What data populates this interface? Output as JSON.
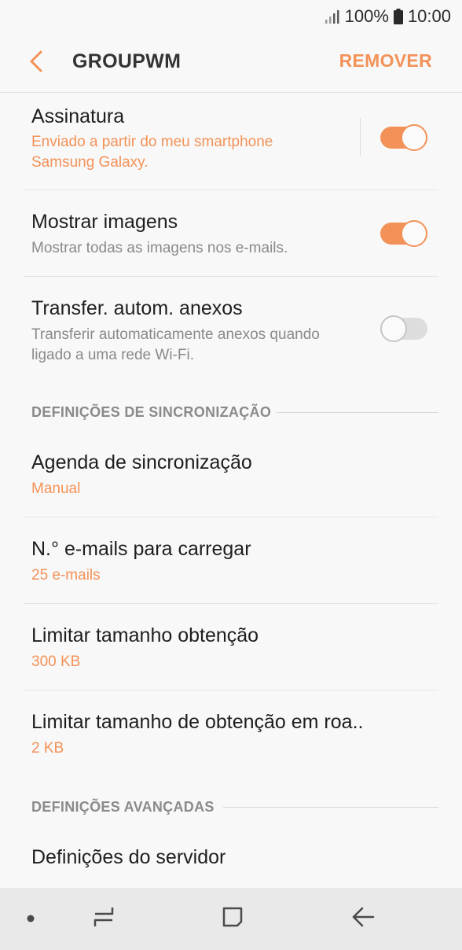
{
  "status_bar": {
    "battery": "100%",
    "time": "10:00"
  },
  "app_bar": {
    "title": "GROUPWM",
    "remove_label": "REMOVER"
  },
  "signature": {
    "title": "Assinatura",
    "subtitle_line1": "Enviado a partir do meu smartphone",
    "subtitle_line2": "Samsung Galaxy.",
    "enabled": true
  },
  "show_images": {
    "title": "Mostrar imagens",
    "subtitle": "Mostrar todas as imagens nos e-mails.",
    "enabled": true
  },
  "auto_download": {
    "title": "Transfer. autom. anexos",
    "subtitle_line1": "Transferir automaticamente anexos quando",
    "subtitle_line2": "ligado a uma rede Wi-Fi.",
    "enabled": false
  },
  "sync_section": {
    "header": "DEFINIÇÕES DE SINCRONIZAÇÃO",
    "items": [
      {
        "title": "Agenda de sincronização",
        "value": "Manual"
      },
      {
        "title": "N.° e-mails para carregar",
        "value": "25 e-mails"
      },
      {
        "title": "Limitar tamanho obtenção",
        "value": "300 KB"
      },
      {
        "title": "Limitar tamanho de obtenção em roa..",
        "value": "2 KB"
      }
    ]
  },
  "advanced_section": {
    "header": "DEFINIÇÕES AVANÇADAS",
    "items": [
      {
        "title": "Definições do servidor"
      }
    ]
  },
  "colors": {
    "accent": "#f39258",
    "toggle_off": "#dddddd",
    "background": "#f8f8f8",
    "nav_bar": "#e9e9e9"
  },
  "icons": [
    "signal-icon",
    "battery-icon",
    "back-arrow-icon",
    "recent-apps-icon",
    "home-icon",
    "nav-back-icon",
    "nav-dot-icon"
  ]
}
